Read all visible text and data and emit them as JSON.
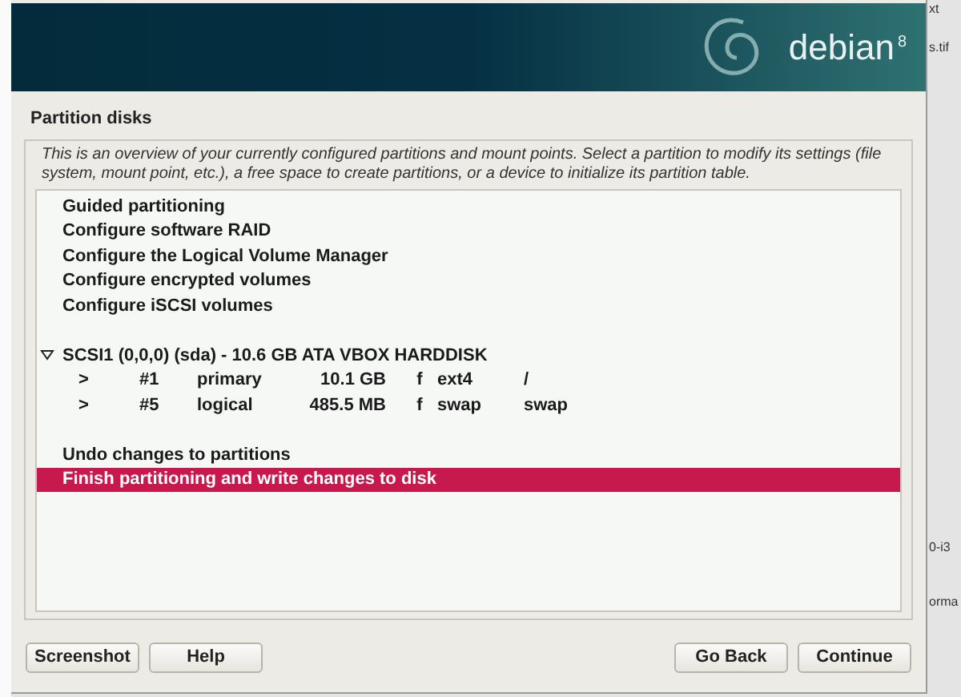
{
  "background_fragments": [
    "xt",
    "s.tif",
    "0-i3",
    "orma"
  ],
  "banner": {
    "logo": "debian",
    "version": "8"
  },
  "window": {
    "title": "Partition disks"
  },
  "description": "This is an overview of your currently configured partitions and mount points. Select a partition to modify its settings (file system, mount point, etc.), a free space to create partitions, or a device to initialize its partition table.",
  "items": [
    {
      "kind": "action",
      "label": "Guided partitioning",
      "selected": false
    },
    {
      "kind": "action",
      "label": "Configure software RAID",
      "selected": false
    },
    {
      "kind": "action",
      "label": "Configure the Logical Volume Manager",
      "selected": false
    },
    {
      "kind": "action",
      "label": "Configure encrypted volumes",
      "selected": false
    },
    {
      "kind": "action",
      "label": "Configure iSCSI volumes",
      "selected": false
    },
    {
      "kind": "blank"
    },
    {
      "kind": "disk",
      "label": "SCSI1 (0,0,0) (sda) - 10.6 GB ATA VBOX HARDDISK",
      "expanded": true,
      "selected": false
    },
    {
      "kind": "partition",
      "cells": [
        ">",
        "#1",
        "primary",
        "10.1 GB",
        "f",
        "ext4",
        "/"
      ],
      "selected": false
    },
    {
      "kind": "partition",
      "cells": [
        ">",
        "#5",
        "logical",
        "485.5 MB",
        "f",
        "swap",
        "swap"
      ],
      "selected": false
    },
    {
      "kind": "blank"
    },
    {
      "kind": "action",
      "label": "Undo changes to partitions",
      "selected": false
    },
    {
      "kind": "action",
      "label": "Finish partitioning and write changes to disk",
      "selected": true
    }
  ],
  "buttons_left": [
    "Screenshot",
    "Help"
  ],
  "buttons_right": [
    "Go Back",
    "Continue"
  ]
}
